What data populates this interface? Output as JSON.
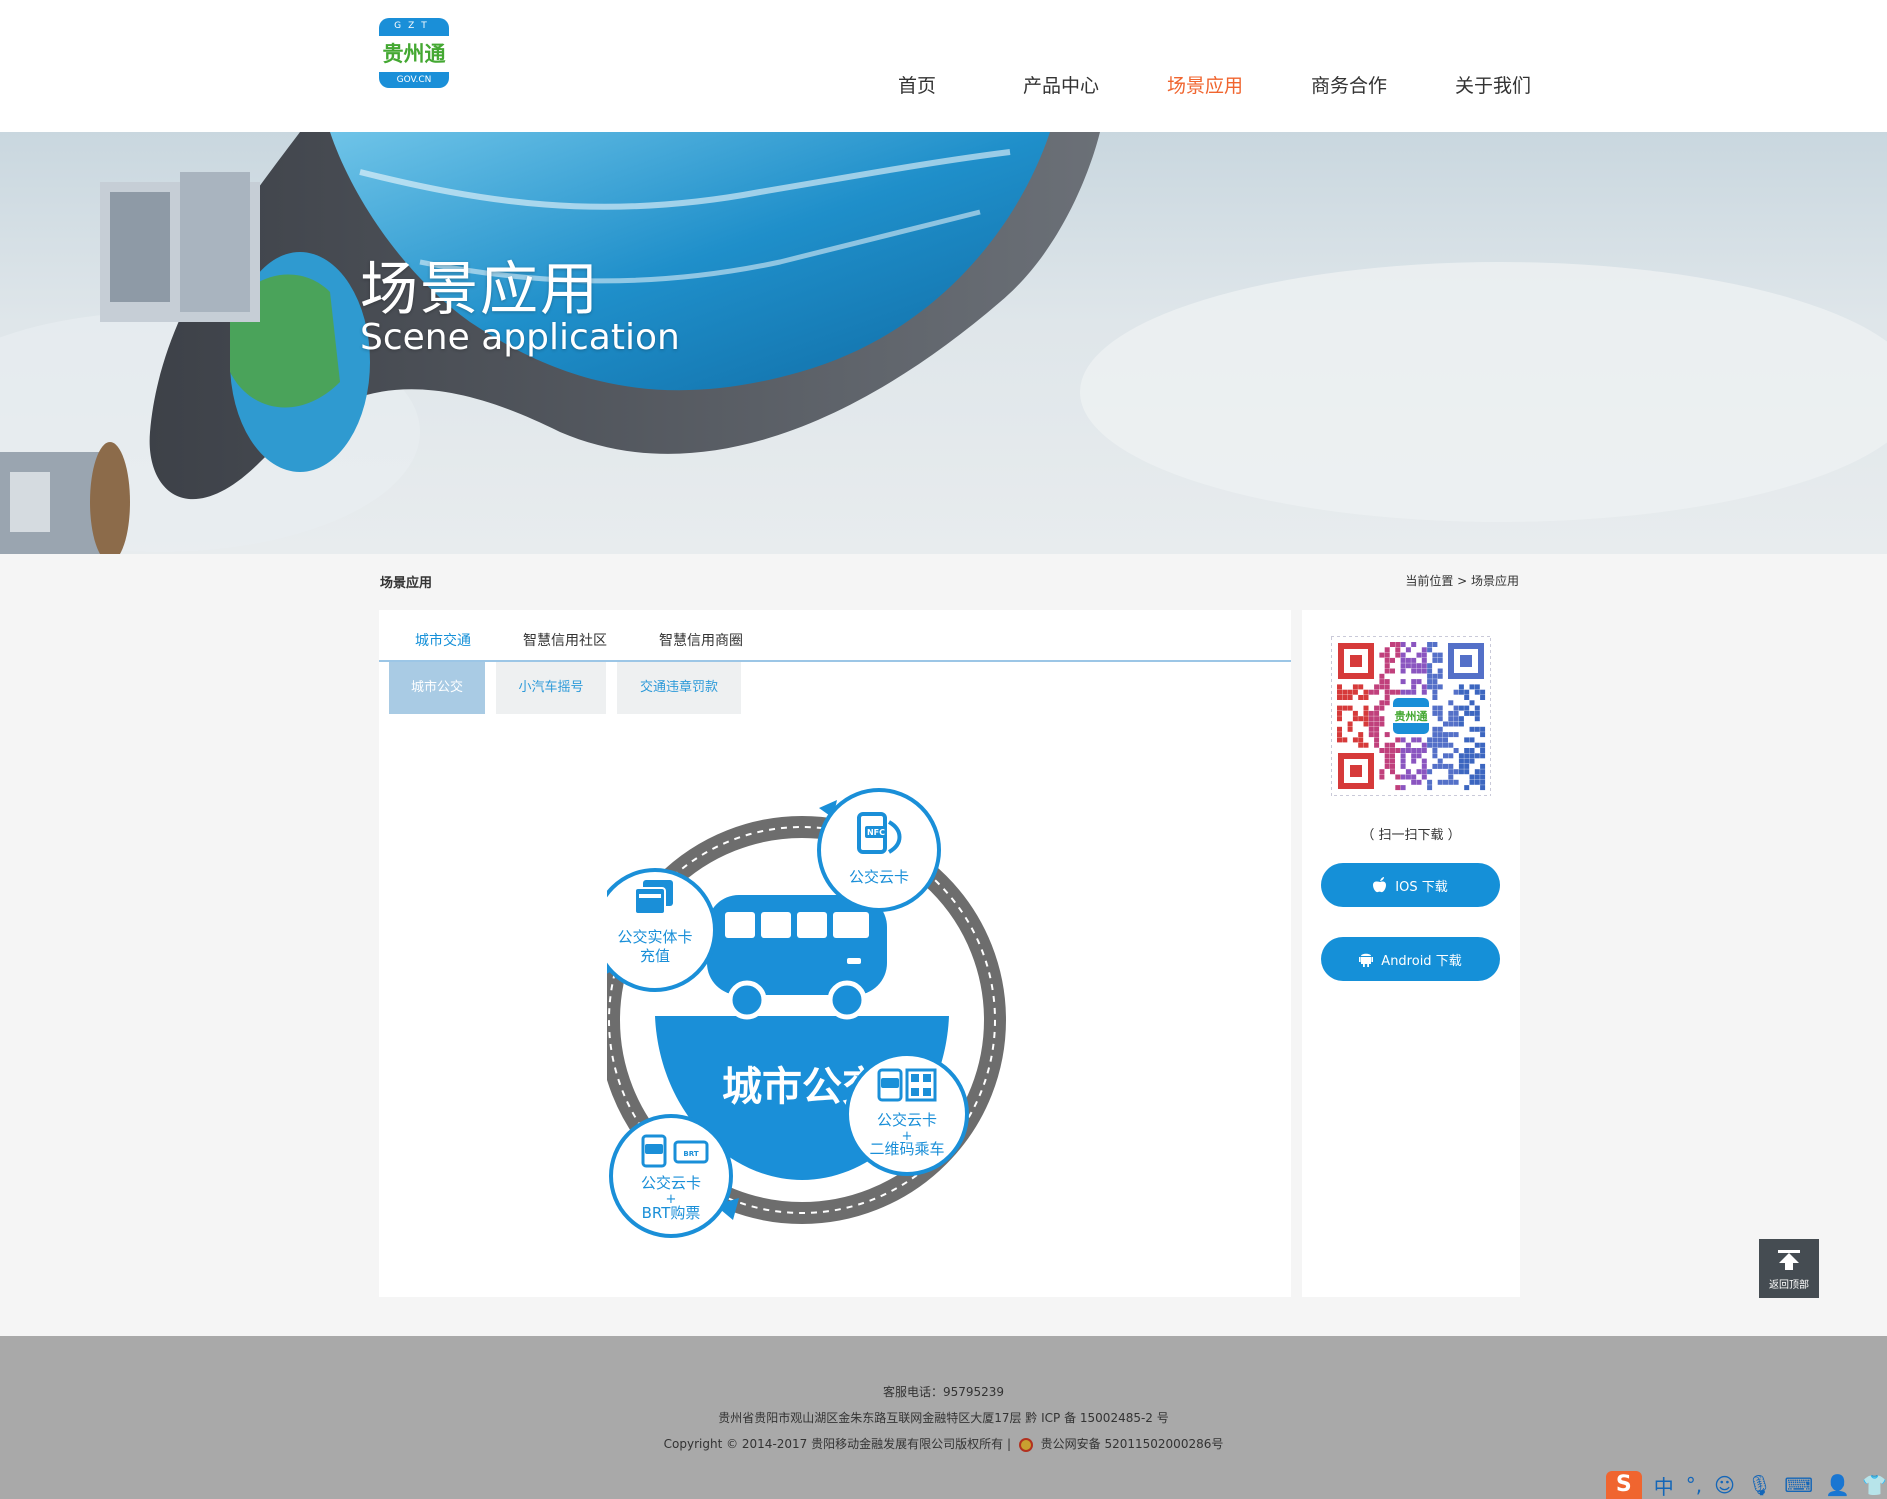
{
  "header": {
    "logo": {
      "top": "GZT",
      "mid": "贵州通",
      "bot": "GOV.CN"
    },
    "nav": [
      {
        "label": "首页",
        "active": false
      },
      {
        "label": "产品中心",
        "active": false
      },
      {
        "label": "场景应用",
        "active": true
      },
      {
        "label": "商务合作",
        "active": false
      },
      {
        "label": "关于我们",
        "active": false
      }
    ]
  },
  "banner": {
    "title": "场景应用",
    "subtitle": "Scene application"
  },
  "section": {
    "title": "场景应用",
    "breadcrumb": "当前位置 > 场景应用"
  },
  "tabs": [
    "城市交通",
    "智慧信用社区",
    "智慧信用商圈"
  ],
  "subtabs": [
    "城市公交",
    "小汽车摇号",
    "交通违章罚款"
  ],
  "diagram": {
    "center": "城市公交",
    "bubbles": {
      "top_right": "公交云卡",
      "top_left_1": "公交实体卡",
      "top_left_2": "充值",
      "bottom_right_1": "公交云卡",
      "bottom_right_2": "+",
      "bottom_right_3": "二维码乘车",
      "bottom_left_1": "公交云卡",
      "bottom_left_2": "+",
      "bottom_left_3": "BRT购票"
    },
    "icon_labels": {
      "nfc": "NFC",
      "brt": "BRT"
    }
  },
  "sidebar": {
    "scan": "（ 扫一扫下载 ）",
    "ios": "IOS 下载",
    "android": "Android 下载"
  },
  "backtop": "返回顶部",
  "footer": {
    "phone": "客服电话：95795239",
    "address": "贵州省贵阳市观山湖区金朱东路互联网金融特区大厦17层 黔 ICP 备 15002485-2 号",
    "copyright": "Copyright © 2014-2017 贵阳移动金融发展有限公司版权所有 |",
    "police": "贵公网安备 52011502000286号"
  },
  "ime": {
    "mark": "S",
    "lang": "中"
  },
  "colors": {
    "accent": "#1590d8",
    "nav_active": "#f0652f",
    "footer_bg": "#a9a9a9"
  }
}
